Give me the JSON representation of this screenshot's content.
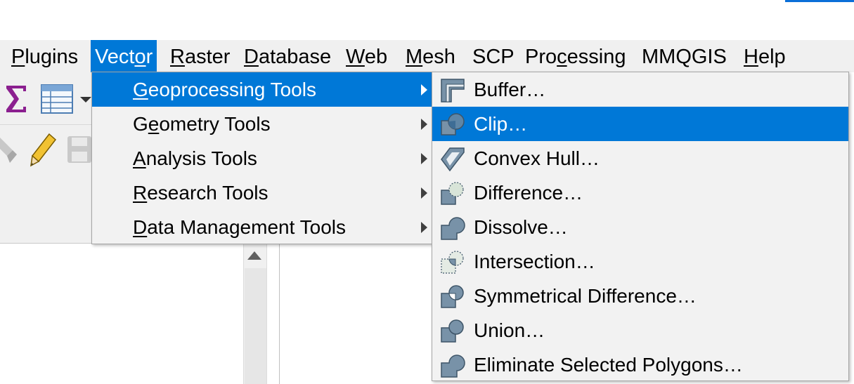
{
  "menubar": {
    "items": [
      {
        "pre": "",
        "u": "P",
        "post": "lugins"
      },
      {
        "pre": "Vect",
        "u": "o",
        "post": "r"
      },
      {
        "pre": "",
        "u": "R",
        "post": "aster"
      },
      {
        "pre": "",
        "u": "D",
        "post": "atabase"
      },
      {
        "pre": "",
        "u": "W",
        "post": "eb"
      },
      {
        "pre": "",
        "u": "M",
        "post": "esh"
      },
      {
        "pre": "SCP",
        "u": "",
        "post": ""
      },
      {
        "pre": "Pro",
        "u": "c",
        "post": "essing"
      },
      {
        "pre": "MMQGIS",
        "u": "",
        "post": ""
      },
      {
        "pre": "",
        "u": "H",
        "post": "elp"
      }
    ],
    "active": "Vector"
  },
  "vector_menu": {
    "items": [
      {
        "pre": "",
        "u": "G",
        "post": "eoprocessing Tools",
        "submenu": true,
        "highlighted": true
      },
      {
        "pre": "G",
        "u": "e",
        "post": "ometry Tools",
        "submenu": true,
        "highlighted": false
      },
      {
        "pre": "",
        "u": "A",
        "post": "nalysis Tools",
        "submenu": true,
        "highlighted": false
      },
      {
        "pre": "",
        "u": "R",
        "post": "esearch Tools",
        "submenu": true,
        "highlighted": false
      },
      {
        "pre": "",
        "u": "D",
        "post": "ata Management Tools",
        "submenu": true,
        "highlighted": false
      }
    ]
  },
  "geoprocessing_menu": {
    "items": [
      {
        "label": "Buffer…",
        "icon": "buffer-icon",
        "highlighted": false
      },
      {
        "label": "Clip…",
        "icon": "clip-icon",
        "highlighted": true
      },
      {
        "label": "Convex Hull…",
        "icon": "convex-hull-icon",
        "highlighted": false
      },
      {
        "label": "Difference…",
        "icon": "difference-icon",
        "highlighted": false
      },
      {
        "label": "Dissolve…",
        "icon": "dissolve-icon",
        "highlighted": false
      },
      {
        "label": "Intersection…",
        "icon": "intersection-icon",
        "highlighted": false
      },
      {
        "label": "Symmetrical Difference…",
        "icon": "symmetrical-difference-icon",
        "highlighted": false
      },
      {
        "label": "Union…",
        "icon": "union-icon",
        "highlighted": false
      },
      {
        "label": "Eliminate Selected Polygons…",
        "icon": "eliminate-icon",
        "highlighted": false
      }
    ]
  },
  "toolbar": {
    "icons": [
      "sigma-icon",
      "attribute-table-icon",
      "dropdown-arrow-icon",
      "digitize-icon",
      "pencil-icon",
      "save-edits-icon"
    ]
  },
  "colors": {
    "highlight": "#0078d7",
    "menu_bg": "#f2f2f2",
    "menubar_bg": "#f0f0f0",
    "icon_fill": "#7892a8",
    "icon_stroke": "#3e5568",
    "sigma": "#8b1f8f"
  }
}
